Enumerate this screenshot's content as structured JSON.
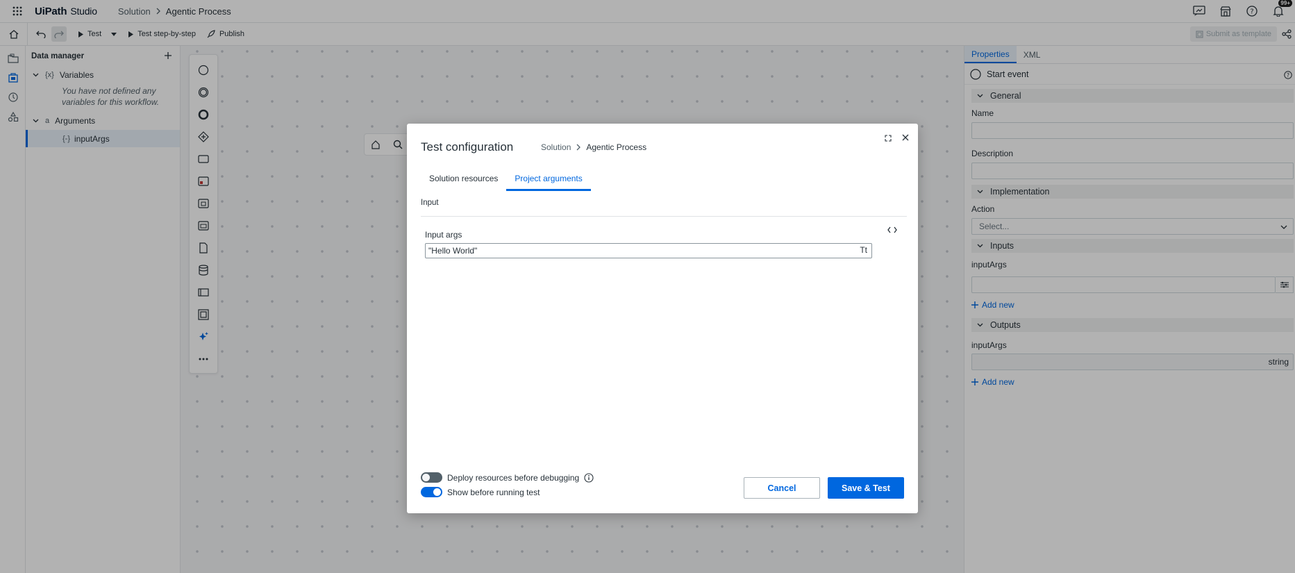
{
  "app": {
    "logo": "UiPath",
    "product": "Studio",
    "breadcrumb": {
      "parent": "Solution",
      "current": "Agentic Process"
    },
    "notifications_badge": "99+"
  },
  "toolbar": {
    "test_label": "Test",
    "step_label": "Test step-by-step",
    "publish_label": "Publish",
    "submit_label": "Submit as template"
  },
  "data_manager": {
    "title": "Data manager",
    "variables_tag": "{x}",
    "variables_label": "Variables",
    "variables_empty": "You have not defined any variables for this workflow.",
    "arguments_tag": "a",
    "arguments_label": "Arguments",
    "arg_tag": "{-}",
    "arg_item": "inputArgs"
  },
  "properties": {
    "tabs": [
      "Properties",
      "XML"
    ],
    "event": "Start event",
    "general": "General",
    "name_label": "Name",
    "name_value": "",
    "description_label": "Description",
    "description_value": "",
    "implementation": "Implementation",
    "action_label": "Action",
    "action_placeholder": "Select...",
    "inputs": "Inputs",
    "input_arg_label": "inputArgs",
    "input_arg_value": "",
    "add_new_label": "Add new",
    "outputs": "Outputs",
    "output_arg_label": "inputArgs",
    "output_arg_type": "string"
  },
  "modal": {
    "title": "Test configuration",
    "breadcrumb": {
      "parent": "Solution",
      "current": "Agentic Process"
    },
    "tabs": [
      "Solution resources",
      "Project arguments"
    ],
    "section": "Input",
    "input_label": "Input args",
    "input_value": "\"Hello World\"",
    "type_glyph": "Tt",
    "deploy_label": "Deploy resources before debugging",
    "deploy_on": false,
    "show_label": "Show before running test",
    "show_on": true,
    "cancel_label": "Cancel",
    "save_label": "Save & Test"
  },
  "colors": {
    "accent": "#0067df",
    "text": "#273139",
    "muted": "#526069"
  }
}
